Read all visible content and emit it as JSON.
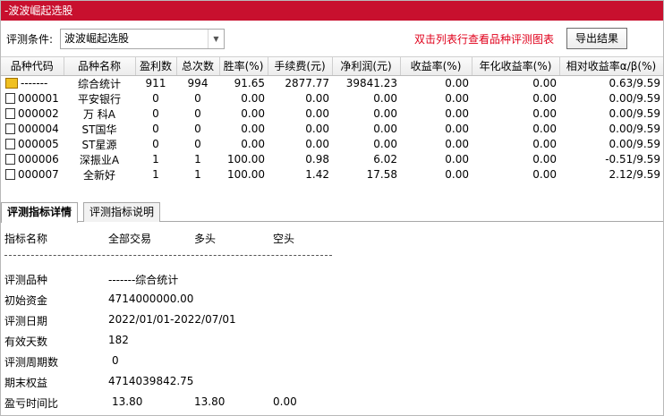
{
  "window": {
    "title": "-波波崛起选股"
  },
  "toolbar": {
    "condition_label": "评测条件:",
    "condition_value": "波波崛起选股",
    "hint": "双击列表行查看品种评测图表",
    "export_label": "导出结果"
  },
  "grid": {
    "headers": [
      "品种代码",
      "品种名称",
      "盈利数",
      "总次数",
      "胜率(%)",
      "手续费(元)",
      "净利润(元)",
      "收益率(%)",
      "年化收益率(%)",
      "相对收益率α/β(%)"
    ],
    "rows": [
      [
        "-------",
        "综合统计",
        "911",
        "994",
        "91.65",
        "2877.77",
        "39841.23",
        "0.00",
        "0.00",
        "0.63/9.59"
      ],
      [
        "000001",
        "平安银行",
        "0",
        "0",
        "0.00",
        "0.00",
        "0.00",
        "0.00",
        "0.00",
        "0.00/9.59"
      ],
      [
        "000002",
        "万 科A",
        "0",
        "0",
        "0.00",
        "0.00",
        "0.00",
        "0.00",
        "0.00",
        "0.00/9.59"
      ],
      [
        "000004",
        "ST国华",
        "0",
        "0",
        "0.00",
        "0.00",
        "0.00",
        "0.00",
        "0.00",
        "0.00/9.59"
      ],
      [
        "000005",
        "ST星源",
        "0",
        "0",
        "0.00",
        "0.00",
        "0.00",
        "0.00",
        "0.00",
        "0.00/9.59"
      ],
      [
        "000006",
        "深振业A",
        "1",
        "1",
        "100.00",
        "0.98",
        "6.02",
        "0.00",
        "0.00",
        "-0.51/9.59"
      ],
      [
        "000007",
        "全新好",
        "1",
        "1",
        "100.00",
        "1.42",
        "17.58",
        "0.00",
        "0.00",
        "2.12/9.59"
      ]
    ]
  },
  "tabs": [
    {
      "label": "评测指标详情",
      "active": true
    },
    {
      "label": "评测指标说明",
      "active": false
    }
  ],
  "detail": {
    "header": {
      "name": "指标名称",
      "all": "全部交易",
      "long": "多头",
      "short": "空头"
    },
    "items": [
      {
        "label": "评测品种",
        "value": "-------综合统计"
      },
      {
        "label": "初始资金",
        "value": "4714000000.00"
      },
      {
        "label": "评测日期",
        "value": "2022/01/01-2022/07/01"
      },
      {
        "label": "有效天数",
        "value": "182"
      },
      {
        "label": "评测周期数",
        "value": "0"
      },
      {
        "label": "期末权益",
        "value": "4714039842.75"
      },
      {
        "label": "盈亏时间比",
        "value": "13.80",
        "value_long": "13.80",
        "value_short": "0.00"
      }
    ]
  }
}
